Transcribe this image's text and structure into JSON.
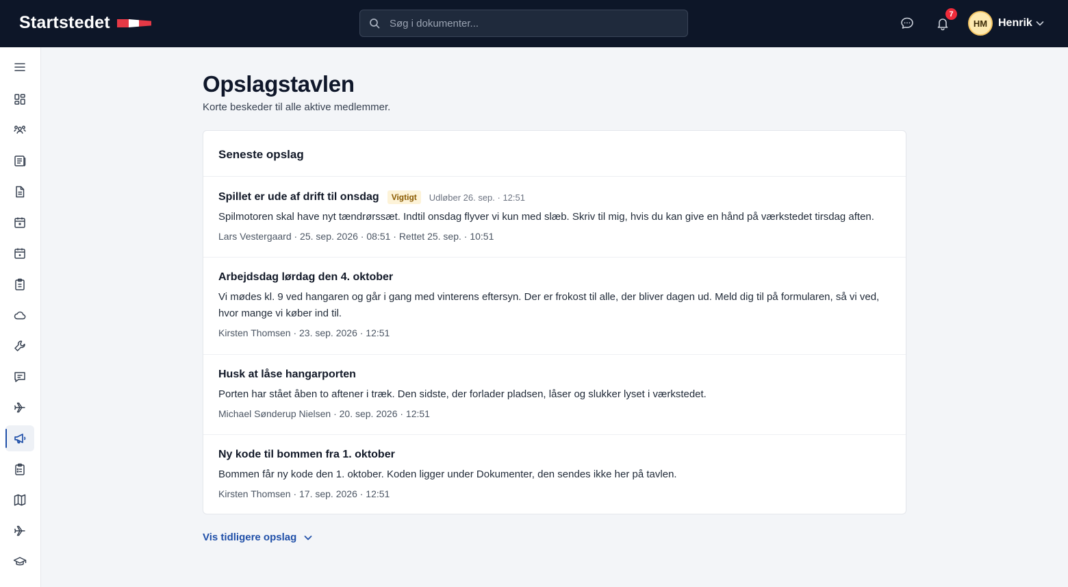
{
  "header": {
    "brand": "Startstedet",
    "search_placeholder": "Søg i dokumenter...",
    "notification_count": "7",
    "user_initials": "HM",
    "user_name": "Henrik"
  },
  "sidebar": {
    "items": [
      {
        "icon": "menu-icon"
      },
      {
        "icon": "dashboard-icon"
      },
      {
        "icon": "members-icon"
      },
      {
        "icon": "newspaper-icon"
      },
      {
        "icon": "document-icon"
      },
      {
        "icon": "calendar-icon"
      },
      {
        "icon": "calendar-day-icon"
      },
      {
        "icon": "clipboard-icon"
      },
      {
        "icon": "cloud-icon"
      },
      {
        "icon": "wrench-icon"
      },
      {
        "icon": "chat-icon"
      },
      {
        "icon": "plane-icon"
      },
      {
        "icon": "megaphone-icon",
        "active": true
      },
      {
        "icon": "checklist-icon"
      },
      {
        "icon": "map-icon"
      },
      {
        "icon": "plane-icon"
      },
      {
        "icon": "graduation-cap-icon"
      }
    ]
  },
  "main": {
    "title": "Opslagstavlen",
    "subtitle": "Korte beskeder til alle aktive medlemmer.",
    "card_title": "Seneste opslag",
    "posts": [
      {
        "title": "Spillet er ude af drift til onsdag",
        "tag": "Vigtigt",
        "expiry": "Udløber 26. sep. · 12:51",
        "body": "Spilmotoren skal have nyt tændrørssæt. Indtil onsdag flyver vi kun med slæb. Skriv til mig, hvis du kan give en hånd på værkstedet tirsdag aften.",
        "meta": "Lars Vestergaard · 25. sep. 2026 · 08:51 · Rettet 25. sep. · 10:51"
      },
      {
        "title": "Arbejdsdag lørdag den 4. oktober",
        "body": "Vi mødes kl. 9 ved hangaren og går i gang med vinterens eftersyn. Der er frokost til alle, der bliver dagen ud. Meld dig til på formularen, så vi ved, hvor mange vi køber ind til.",
        "meta": "Kirsten Thomsen · 23. sep. 2026 · 12:51"
      },
      {
        "title": "Husk at låse hangarporten",
        "body": "Porten har stået åben to aftener i træk. Den sidste, der forlader pladsen, låser og slukker lyset i værkstedet.",
        "meta": "Michael Sønderup Nielsen · 20. sep. 2026 · 12:51"
      },
      {
        "title": "Ny kode til bommen fra 1. oktober",
        "body": "Bommen får ny kode den 1. oktober. Koden ligger under Dokumenter, den sendes ikke her på tavlen.",
        "meta": "Kirsten Thomsen · 17. sep. 2026 · 12:51"
      }
    ],
    "more_label": "Vis tidligere opslag"
  },
  "colors": {
    "topbar": "#0d1628",
    "accent": "#1f4fa8",
    "badge": "#ef2b3a",
    "tag_bg": "#fdf3d8",
    "tag_text": "#8a5a00"
  }
}
